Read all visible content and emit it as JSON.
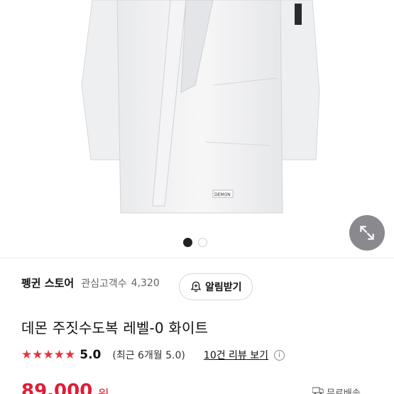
{
  "product_image": {
    "tag_text": "DEMON",
    "icon": "jacket-image"
  },
  "expand_icon": "expand-arrows-icon",
  "carousel": {
    "total": 2,
    "active": 1
  },
  "store": {
    "name": "펭귄 스토어",
    "fan_label": "관심고객수",
    "fan_count": "4,320",
    "alert_button": "알림받기"
  },
  "product": {
    "title": "데몬 주짓수도복 레벨-0 화이트",
    "rating": "5.0",
    "recent_rating": "(최근 6개월 5.0)",
    "review_link": "10건 리뷰 보기",
    "price": "89,000",
    "price_unit": "원",
    "shipping": "무료배송"
  },
  "colors": {
    "star": "#e8333f",
    "price": "#e01d36"
  }
}
